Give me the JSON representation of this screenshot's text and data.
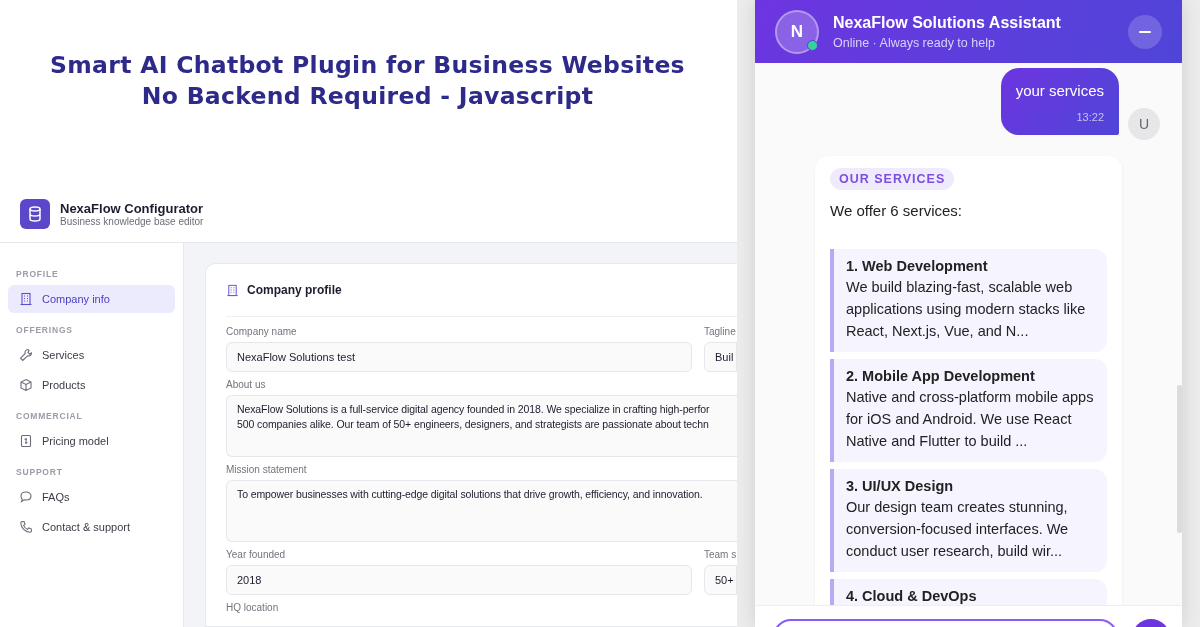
{
  "banner": {
    "lines": [
      "Smart AI Chatbot Plugin for Business Websites",
      "No Backend Required - Javascript"
    ]
  },
  "configurator": {
    "title": "NexaFlow Configurator",
    "subtitle": "Business knowledge base editor",
    "sidebar": [
      {
        "heading": "PROFILE",
        "items": [
          {
            "label": "Company info",
            "selected": true
          }
        ]
      },
      {
        "heading": "OFFERINGS",
        "items": [
          {
            "label": "Services",
            "selected": false
          },
          {
            "label": "Products",
            "selected": false
          }
        ]
      },
      {
        "heading": "COMMERCIAL",
        "items": [
          {
            "label": "Pricing model",
            "selected": false
          }
        ]
      },
      {
        "heading": "SUPPORT",
        "items": [
          {
            "label": "FAQs",
            "selected": false
          },
          {
            "label": "Contact & support",
            "selected": false
          }
        ]
      }
    ],
    "card": {
      "title": "Company profile",
      "rows": [
        {
          "fields": [
            {
              "kind": "input",
              "label": "Company name",
              "value": "NexaFlow Solutions test"
            },
            {
              "kind": "input",
              "label": "Tagline",
              "value": "Buil"
            }
          ]
        },
        {
          "fields": [
            {
              "kind": "textarea",
              "label": "About us",
              "lines": [
                "NexaFlow Solutions is a full-service digital agency founded in 2018. We specialize in crafting high-perfor",
                "500 companies alike. Our team of 50+ engineers, designers, and strategists are passionate about techn"
              ]
            }
          ]
        },
        {
          "fields": [
            {
              "kind": "textarea",
              "label": "Mission statement",
              "lines": [
                "To empower businesses with cutting-edge digital solutions that drive growth, efficiency, and innovation."
              ]
            }
          ]
        },
        {
          "fields": [
            {
              "kind": "input",
              "label": "Year founded",
              "value": "2018"
            },
            {
              "kind": "input",
              "label": "Team s",
              "value": "50+"
            }
          ]
        },
        {
          "fields": [
            {
              "kind": "label",
              "label": "HQ location"
            }
          ]
        }
      ]
    }
  },
  "chat": {
    "title": "NexaFlow Solutions Assistant",
    "subtitle": "Online · Always ready to help",
    "avatar": "N",
    "online": true,
    "messages": [
      {
        "kind": "user",
        "text": "your services",
        "time": "13:22",
        "avatar": "U"
      },
      {
        "kind": "bot",
        "badge": "OUR SERVICES",
        "intro": "We offer 6 services:",
        "items": [
          {
            "title": "1. Web Development",
            "text": "We build blazing-fast, scalable web applications using modern stacks like React, Next.js, Vue, and N..."
          },
          {
            "title": "2. Mobile App Development",
            "text": "Native and cross-platform mobile apps for iOS and Android. We use React Native and Flutter to build ..."
          },
          {
            "title": "3. UI/UX Design",
            "text": "Our design team creates stunning, conversion-focused interfaces. We conduct user research, build wir..."
          },
          {
            "title": "4. Cloud & DevOps"
          }
        ]
      }
    ]
  }
}
